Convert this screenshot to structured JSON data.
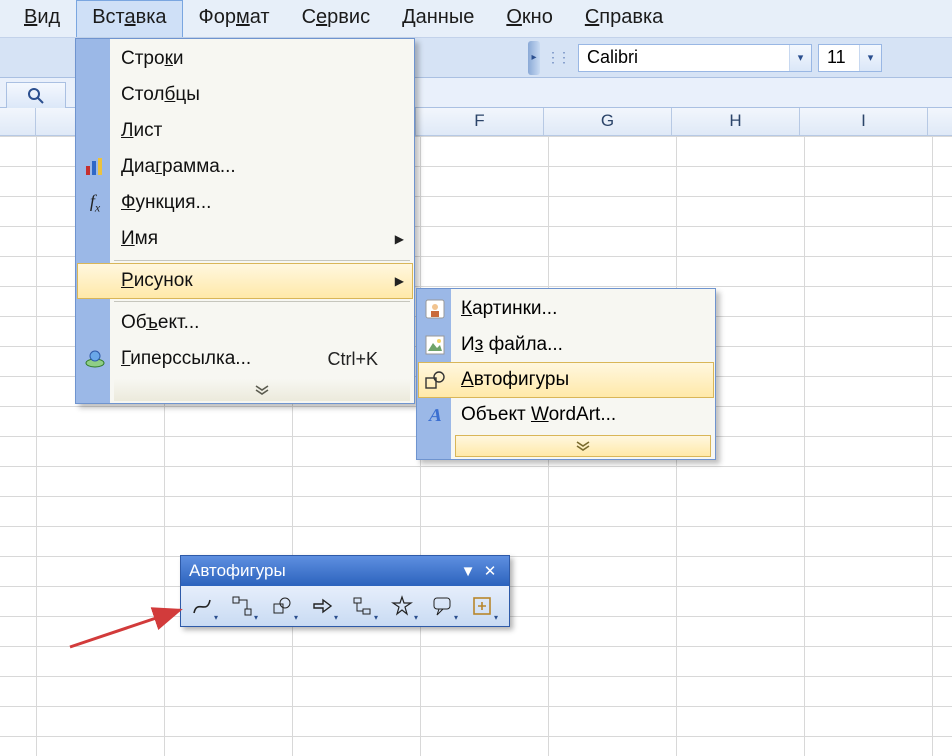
{
  "menubar": {
    "items": [
      {
        "label": "Вид",
        "accel": "В"
      },
      {
        "label": "Вставка",
        "accel": "а",
        "open": true
      },
      {
        "label": "Формат",
        "accel": "м"
      },
      {
        "label": "Сервис",
        "accel": "е"
      },
      {
        "label": "Данные",
        "accel": "Д"
      },
      {
        "label": "Окно",
        "accel": "О"
      },
      {
        "label": "Справка",
        "accel": "С"
      }
    ]
  },
  "format_toolbar": {
    "font_name": "Calibri",
    "font_size": "11"
  },
  "columns": [
    "F",
    "G",
    "H",
    "I"
  ],
  "insert_menu": {
    "rows_label": "Строки",
    "rows_accel": "к",
    "columns_label": "Столбцы",
    "columns_accel": "б",
    "sheet_label": "Лист",
    "sheet_accel": "Л",
    "chart_label": "Диаграмма...",
    "chart_accel": "г",
    "function_label": "Функция...",
    "function_accel": "Ф",
    "name_label": "Имя",
    "name_accel": "И",
    "picture_label": "Рисунок",
    "picture_accel": "Р",
    "object_label": "Объект...",
    "object_accel": "ъ",
    "hyperlink_label": "Гиперссылка...",
    "hyperlink_accel": "Г",
    "hyperlink_shortcut": "Ctrl+K"
  },
  "picture_submenu": {
    "clipart_label": "Картинки...",
    "clipart_accel": "К",
    "fromfile_label": "Из файла...",
    "fromfile_accel": "з",
    "autoshapes_label": "Автофигуры",
    "autoshapes_accel": "А",
    "wordart_label": "Объект WordArt...",
    "wordart_accel": "W"
  },
  "float_toolbar": {
    "title": "Автофигуры"
  }
}
